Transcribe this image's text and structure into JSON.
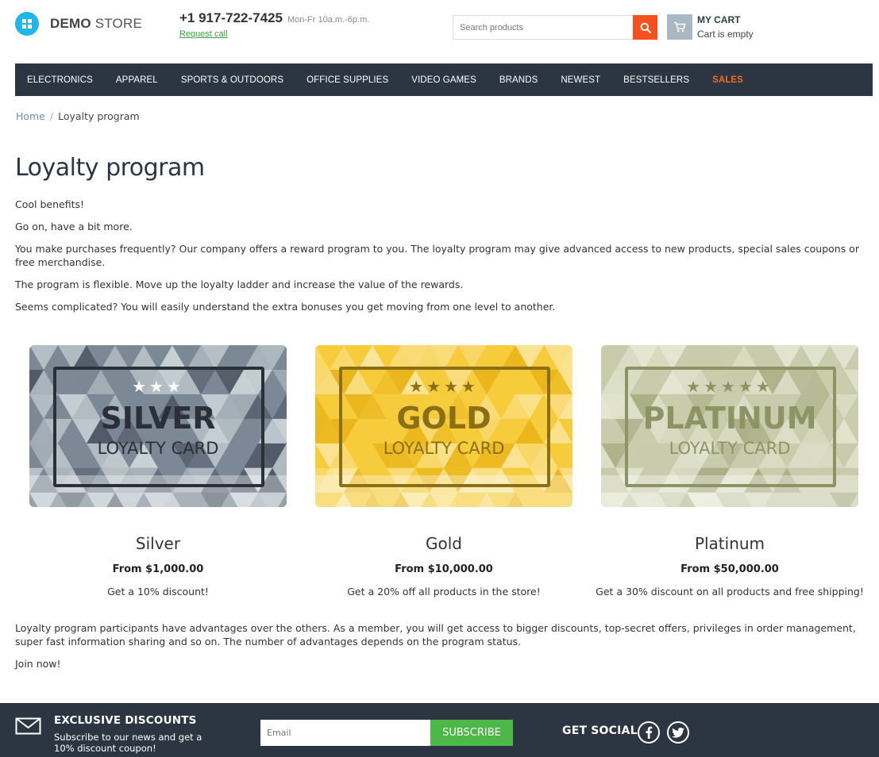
{
  "header": {
    "logo_bold": "DEMO",
    "logo_light": " STORE",
    "phone": "+1 917-722-7425",
    "hours": "Mon-Fr 10a.m.-6p.m.",
    "request_call": "Request call",
    "search_placeholder": "Search products",
    "cart_title": "MY CART",
    "cart_status": "Cart is empty",
    "icons": [
      "logo-icon",
      "search-icon",
      "cart-icon"
    ]
  },
  "nav": {
    "items": [
      "ELECTRONICS",
      "APPAREL",
      "SPORTS & OUTDOORS",
      "OFFICE SUPPLIES",
      "VIDEO GAMES",
      "BRANDS",
      "NEWEST",
      "BESTSELLERS",
      "SALES"
    ]
  },
  "breadcrumb": {
    "home": "Home",
    "separator": "/",
    "current": "Loyalty program"
  },
  "page": {
    "title": "Loyalty program",
    "intro": [
      "Cool benefits!",
      "Go on, have a bit more.",
      "You make purchases frequently? Our company offers a reward program to you. The loyalty program may give advanced access to new products, special sales coupons or free merchandise.",
      "The program is flexible. Move up the loyalty ladder and increase the value of the rewards.",
      "Seems complicated? You will easily understand the extra bonuses you get moving from one level to another."
    ],
    "outro": [
      "Loyalty program participants have advantages over the others. As a member, you will get access to bigger discounts, top-secret offers, privileges in order management, super fast information sharing and so on. The number of advantages depends on the program status.",
      "Join now!"
    ]
  },
  "tiers": [
    {
      "card_stars": "★★★",
      "card_tier": "SILVER",
      "card_sub": "LOYALTY CARD",
      "name": "Silver",
      "price": "From $1,000.00",
      "desc": "Get a 10% discount!",
      "colors": {
        "base": "#7c8896",
        "dark": "#4f5866",
        "light": "#c9d2d6",
        "ink": "#2b3038",
        "star": "#ffffff"
      }
    },
    {
      "card_stars": "★★★★",
      "card_tier": "GOLD",
      "card_sub": "LOYALTY CARD",
      "name": "Gold",
      "price": "From $10,000.00",
      "desc": "Get a 20% off all products in the store!",
      "colors": {
        "base": "#f6cc3c",
        "dark": "#eab51c",
        "light": "#fbe59a",
        "ink": "#8a6f16",
        "star": "#8a6f16"
      }
    },
    {
      "card_stars": "★★★★★",
      "card_tier": "PLATINUM",
      "card_sub": "LOYALTY CARD",
      "name": "Platinum",
      "price": "From $50,000.00",
      "desc": "Get a 30% discount on all products and free shipping!",
      "colors": {
        "base": "#c9ccac",
        "dark": "#a8ac82",
        "light": "#e4e6d2",
        "ink": "#8d9464",
        "star": "#8d9464"
      }
    }
  ],
  "footer": {
    "title": "EXCLUSIVE DISCOUNTS",
    "subtitle": "Subscribe to our news and get a 10% discount coupon!",
    "email_placeholder": "Email",
    "subscribe": "SUBSCRIBE",
    "social_title": "GET SOCIAL",
    "icons": [
      "mail-icon",
      "facebook-icon",
      "twitter-icon"
    ]
  },
  "colors": {
    "nav_bg": "#2b3642",
    "accent_orange": "#f4511e",
    "sales": "#f46a1f",
    "subscribe_green": "#4cb848",
    "logo_blue": "#1fb6e8"
  }
}
